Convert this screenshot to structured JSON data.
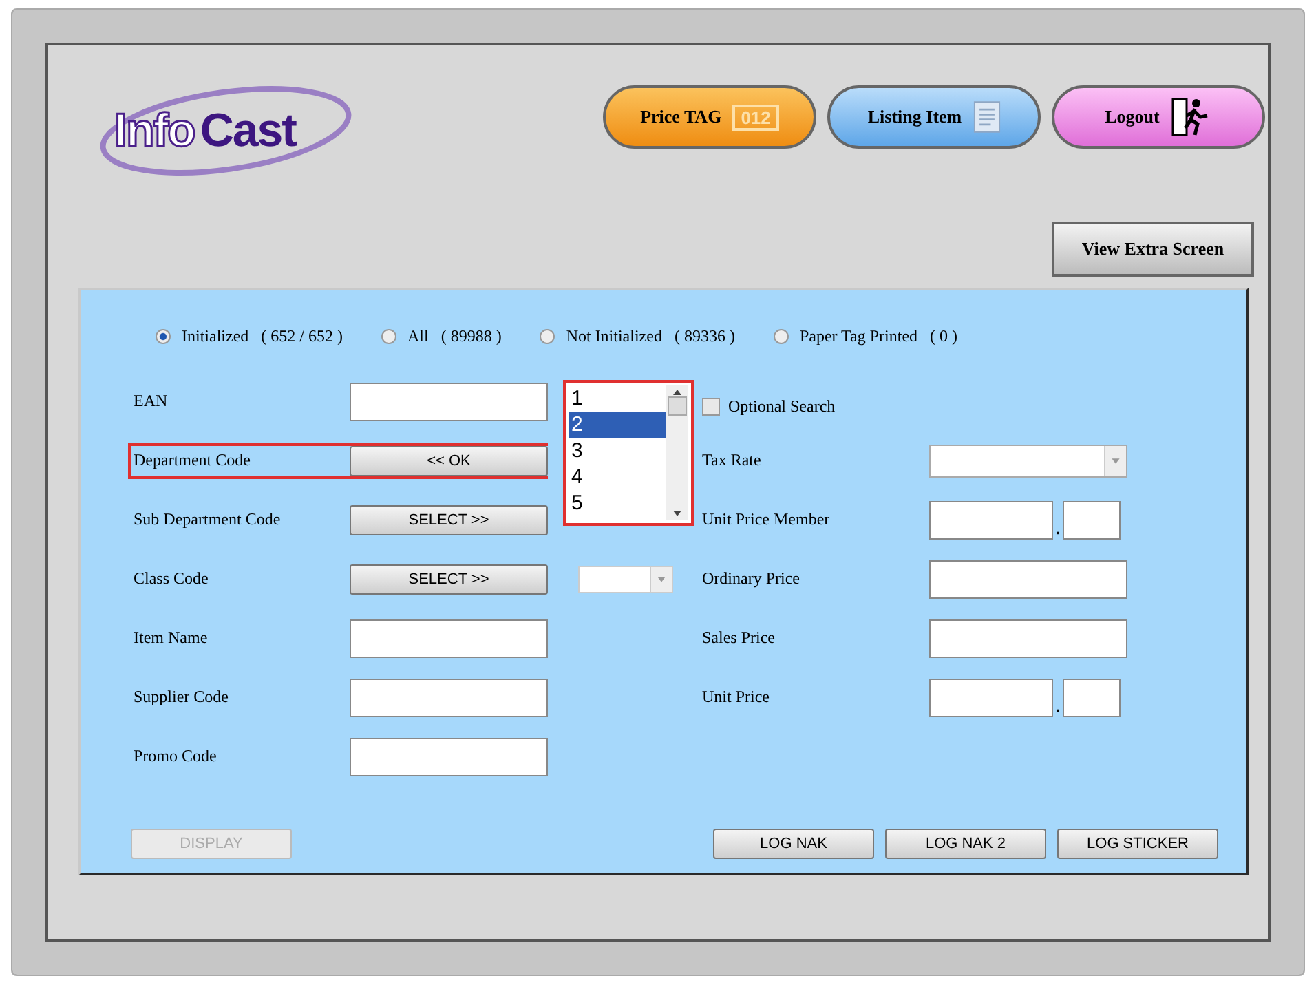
{
  "logo": {
    "part_1": "Info",
    "part_2": "Cast"
  },
  "nav_buttons": [
    {
      "kind": "price",
      "label": "Price TAG",
      "badge": "012"
    },
    {
      "kind": "listing",
      "label": "Listing Item"
    },
    {
      "kind": "logout",
      "label": "Logout"
    }
  ],
  "view_extra_button": "View Extra Screen",
  "filters": [
    {
      "label": "Initialized",
      "count": "( 652 / 652 )",
      "selected": true
    },
    {
      "label": "All",
      "count": "( 89988 )",
      "selected": false
    },
    {
      "label": "Not Initialized",
      "count": "( 89336 )",
      "selected": false
    },
    {
      "label": "Paper Tag Printed",
      "count": "( 0 )",
      "selected": false
    }
  ],
  "left_fields": [
    {
      "kind": "input",
      "label": "EAN",
      "highlighted": false
    },
    {
      "kind": "button",
      "label": "Department Code",
      "button": "<< OK",
      "highlighted": true
    },
    {
      "kind": "button",
      "label": "Sub Department Code",
      "button": "SELECT >>",
      "highlighted": false
    },
    {
      "kind": "button",
      "label": "Class Code",
      "button": "SELECT >>",
      "highlighted": false
    },
    {
      "kind": "input",
      "label": "Item Name",
      "highlighted": false
    },
    {
      "kind": "input",
      "label": "Supplier Code",
      "highlighted": false
    },
    {
      "kind": "input",
      "label": "Promo Code",
      "highlighted": false
    }
  ],
  "department_list": [
    {
      "label": "1",
      "selected": false
    },
    {
      "label": "2",
      "selected": true
    },
    {
      "label": "3",
      "selected": false
    },
    {
      "label": "4",
      "selected": false
    },
    {
      "label": "5",
      "selected": false
    }
  ],
  "optional_search": {
    "label": "Optional Search",
    "checked": false
  },
  "right_fields": [
    {
      "kind": "dropdown",
      "label": "Tax Rate"
    },
    {
      "kind": "split",
      "label": "Unit Price Member",
      "separator": "."
    },
    {
      "kind": "input",
      "label": "Ordinary Price"
    },
    {
      "kind": "input",
      "label": "Sales Price"
    },
    {
      "kind": "split",
      "label": "Unit Price",
      "separator": "."
    }
  ],
  "display_button": {
    "label": "DISPLAY",
    "disabled": true
  },
  "log_buttons": [
    "LOG NAK",
    "LOG NAK 2",
    "LOG STICKER"
  ]
}
